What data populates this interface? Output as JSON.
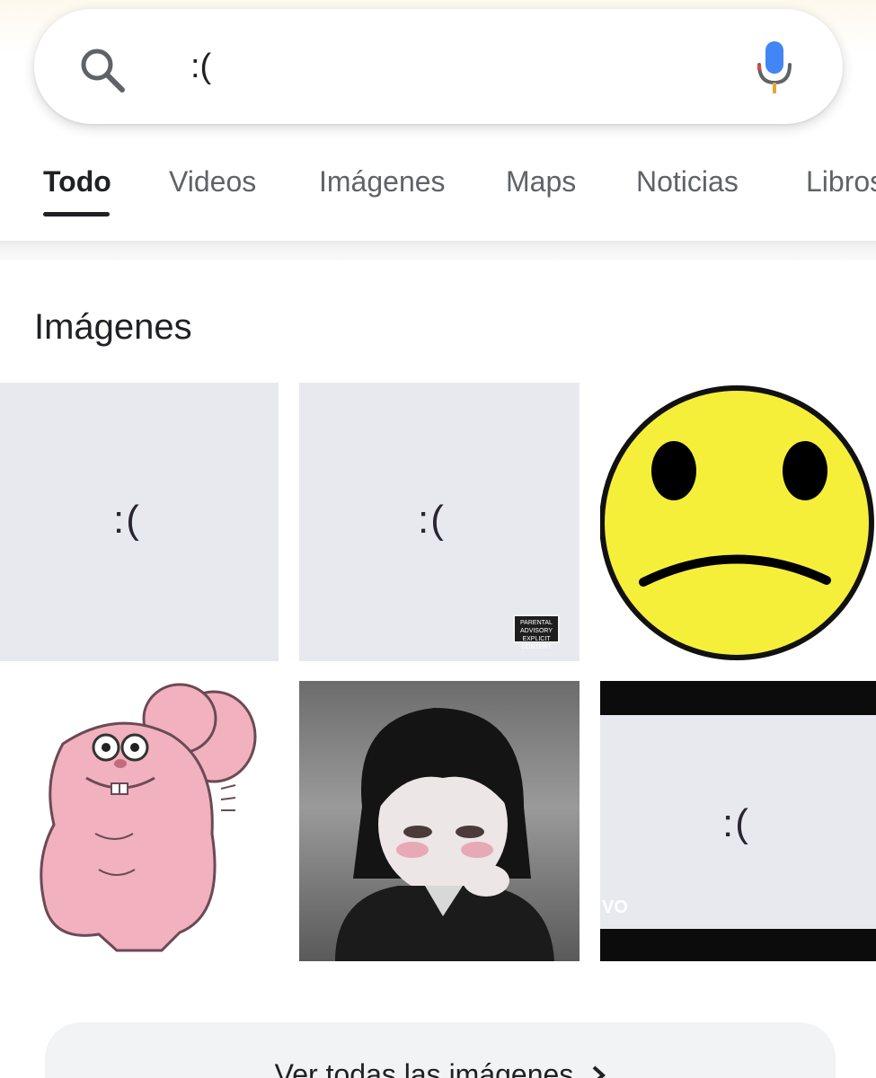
{
  "search": {
    "query": ":(",
    "search_icon": "search-icon",
    "mic_icon": "microphone-icon"
  },
  "tabs": [
    {
      "label": "Todo",
      "active": true
    },
    {
      "label": "Videos",
      "active": false
    },
    {
      "label": "Imágenes",
      "active": false
    },
    {
      "label": "Maps",
      "active": false
    },
    {
      "label": "Noticias",
      "active": false
    },
    {
      "label": "Libros",
      "active": false
    }
  ],
  "images_section": {
    "title": "Imágenes",
    "results": [
      {
        "overlay_text": ":("
      },
      {
        "overlay_text": ":(",
        "badge_text": "PARENTAL ADVISORY EXPLICIT CONTENT"
      },
      {
        "depiction": "yellow sad face"
      },
      {
        "depiction": "pink cartoon rabbit"
      },
      {
        "depiction": "anime girl"
      },
      {
        "overlay_text": ":(",
        "watermark_text": "VO"
      }
    ],
    "see_all_label": "Ver todas las imágenes"
  },
  "colors": {
    "frame_gray": "#e7e9ef",
    "smiley_yellow": "#f5ef3a",
    "rabbit_pink": "#f1b1bf"
  }
}
